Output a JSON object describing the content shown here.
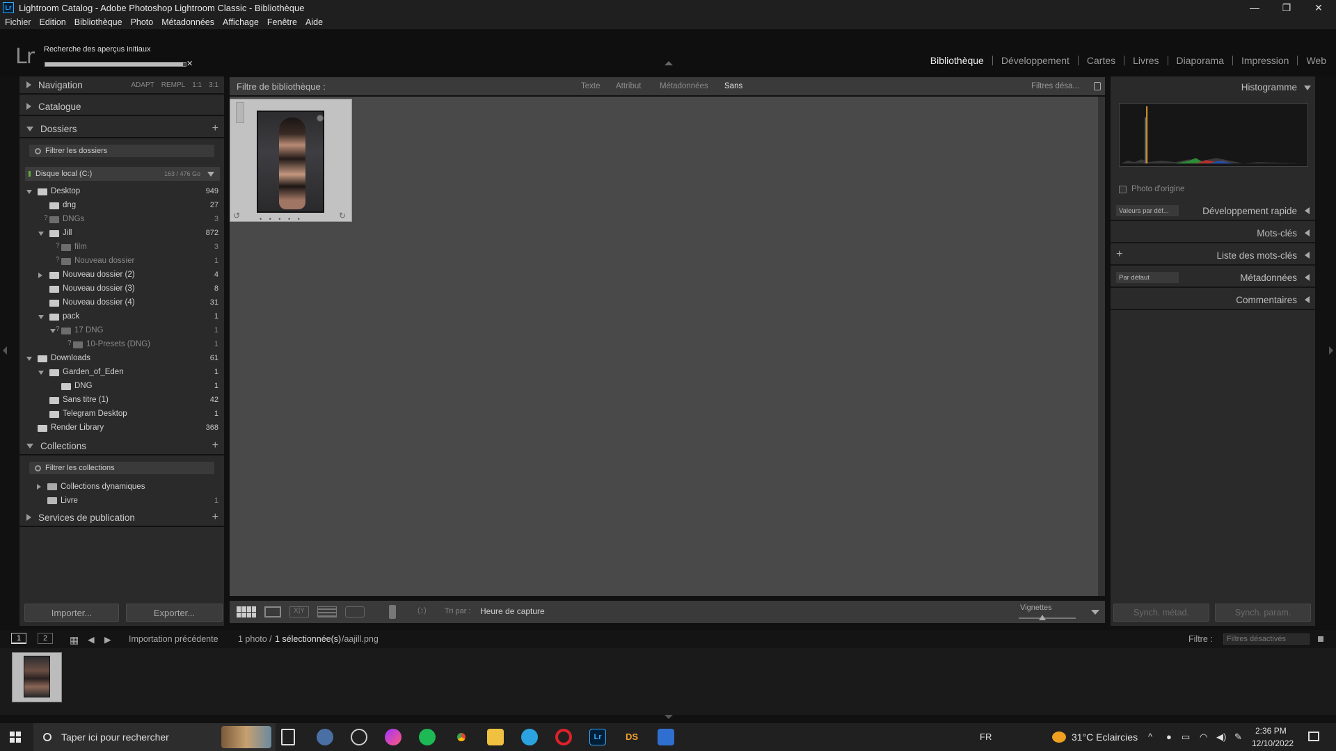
{
  "window": {
    "title": "Lightroom Catalog - Adobe Photoshop Lightroom Classic - Bibliothèque",
    "app_icon": "Lr"
  },
  "menu": [
    "Fichier",
    "Edition",
    "Bibliothèque",
    "Photo",
    "Métadonnées",
    "Affichage",
    "Fenêtre",
    "Aide"
  ],
  "identity": {
    "logo": "Lr",
    "progress_label": "Recherche des aperçus initiaux",
    "progress_fraction": 0.98
  },
  "modules": [
    "Bibliothèque",
    "Développement",
    "Cartes",
    "Livres",
    "Diaporama",
    "Impression",
    "Web"
  ],
  "left": {
    "navigation": {
      "label": "Navigation",
      "options": [
        "ADAPT",
        "REMPL",
        "1:1",
        "3:1"
      ]
    },
    "catalogue": {
      "label": "Catalogue"
    },
    "dossiers": {
      "label": "Dossiers",
      "filter_placeholder": "Filtrer les dossiers",
      "disk": {
        "label": "Disque local (C:)",
        "size": "163 / 476 Go"
      },
      "items": [
        {
          "name": "Desktop",
          "count": "949"
        },
        {
          "name": "dng",
          "count": "27"
        },
        {
          "name": "DNGs",
          "count": "3"
        },
        {
          "name": "Jill",
          "count": "872"
        },
        {
          "name": "film",
          "count": "3"
        },
        {
          "name": "Nouveau dossier",
          "count": "1"
        },
        {
          "name": "Nouveau dossier (2)",
          "count": "4"
        },
        {
          "name": "Nouveau dossier (3)",
          "count": "8"
        },
        {
          "name": "Nouveau dossier (4)",
          "count": "31"
        },
        {
          "name": "pack",
          "count": "1"
        },
        {
          "name": "17 DNG",
          "count": "1"
        },
        {
          "name": "10-Presets (DNG)",
          "count": "1"
        },
        {
          "name": "Downloads",
          "count": "61"
        },
        {
          "name": "Garden_of_Eden",
          "count": "1"
        },
        {
          "name": "DNG",
          "count": "1"
        },
        {
          "name": "Sans titre (1)",
          "count": "42"
        },
        {
          "name": "Telegram Desktop",
          "count": "1"
        },
        {
          "name": "Render Library",
          "count": "368"
        }
      ]
    },
    "collections": {
      "label": "Collections",
      "filter_placeholder": "Filtrer les collections",
      "items": [
        {
          "name": "Collections dynamiques",
          "count": ""
        },
        {
          "name": "Livre",
          "count": "1"
        }
      ]
    },
    "services": {
      "label": "Services de publication"
    },
    "import_label": "Importer...",
    "export_label": "Exporter..."
  },
  "center": {
    "filter_label": "Filtre de bibliothèque :",
    "filter_options": [
      "Texte",
      "Attribut",
      "Métadonnées",
      "Sans"
    ],
    "filter_preset": "Filtres désa...",
    "sort_label": "Tri par :",
    "sort_value": "Heure de capture",
    "thumb_label": "Vignettes"
  },
  "right": {
    "histogram": "Histogramme",
    "original_photo": "Photo d'origine",
    "quick_develop": "Développement rapide",
    "quick_preset": "Valeurs par déf...",
    "keywording": "Mots-clés",
    "keyword_list": "Liste des mots-clés",
    "metadata": "Métadonnées",
    "metadata_preset": "Par défaut",
    "comments": "Commentaires",
    "sync_meta": "Synch. métad.",
    "sync_settings": "Synch. param."
  },
  "filmstrip": {
    "screen1": "1",
    "screen2": "2",
    "source": "Importation précédente",
    "count_prefix": "1 photo /",
    "selected": "1 sélectionnée(s)",
    "filename": "/aajill.png",
    "filter_label": "Filtre :",
    "filter_value": "Filtres désactivés"
  },
  "taskbar": {
    "search_placeholder": "Taper ici pour rechercher",
    "lang": "FR",
    "weather": "31°C  Eclaircies",
    "time": "2:36 PM",
    "date": "12/10/2022"
  }
}
